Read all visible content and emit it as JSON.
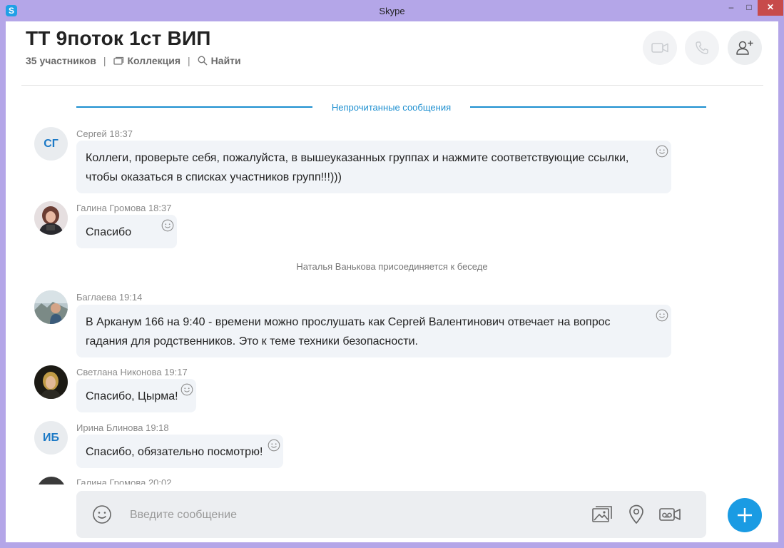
{
  "window": {
    "title": "Skype",
    "app_icon_letter": "S",
    "minimize_glyph": "–",
    "maximize_glyph": "□",
    "close_glyph": "✕"
  },
  "header": {
    "chat_title": "ТТ 9поток 1ст ВИП",
    "participants": "35 участников",
    "separator": "|",
    "collection_label": "Коллекция",
    "search_label": "Найти"
  },
  "unread_divider": "Непрочитанные сообщения",
  "messages": [
    {
      "avatar_initials": "СГ",
      "meta": "Сергей 18:37",
      "text": "Коллеги, проверьте себя, пожалуйста, в вышеуказанных группах и нажмите соответствующие ссылки, чтобы оказаться в списках участников групп!!!)))"
    },
    {
      "meta": "Галина Громова 18:37",
      "text": "Спасибо"
    },
    {
      "meta": "Баглаева 19:14",
      "text": "В Арканум 166 на 9:40 - времени можно прослушать как Сергей Валентинович отвечает на вопрос гадания для родственников. Это к теме техники безопасности."
    },
    {
      "meta": "Светлана Никонова 19:17",
      "text": "Спасибо, Цырма!"
    },
    {
      "avatar_initials": "ИБ",
      "meta": "Ирина Блинова 19:18",
      "text": "Спасибо, обязательно посмотрю!"
    }
  ],
  "system_message": "Наталья Ванькова присоединяется к беседе",
  "partial_message_meta": "Галина Громова 20:02",
  "composer": {
    "placeholder": "Введите сообщение"
  },
  "colors": {
    "accent": "#1a9be3",
    "unread_divider": "#1d8fd0",
    "bubble": "#f1f4f8",
    "window_frame": "#b4a6e8"
  },
  "icons": [
    "video-call-icon",
    "audio-call-icon",
    "add-person-icon",
    "collection-icon",
    "search-icon",
    "smiley-icon",
    "emoji-icon",
    "media-icon",
    "location-icon",
    "video-message-icon",
    "plus-icon"
  ]
}
